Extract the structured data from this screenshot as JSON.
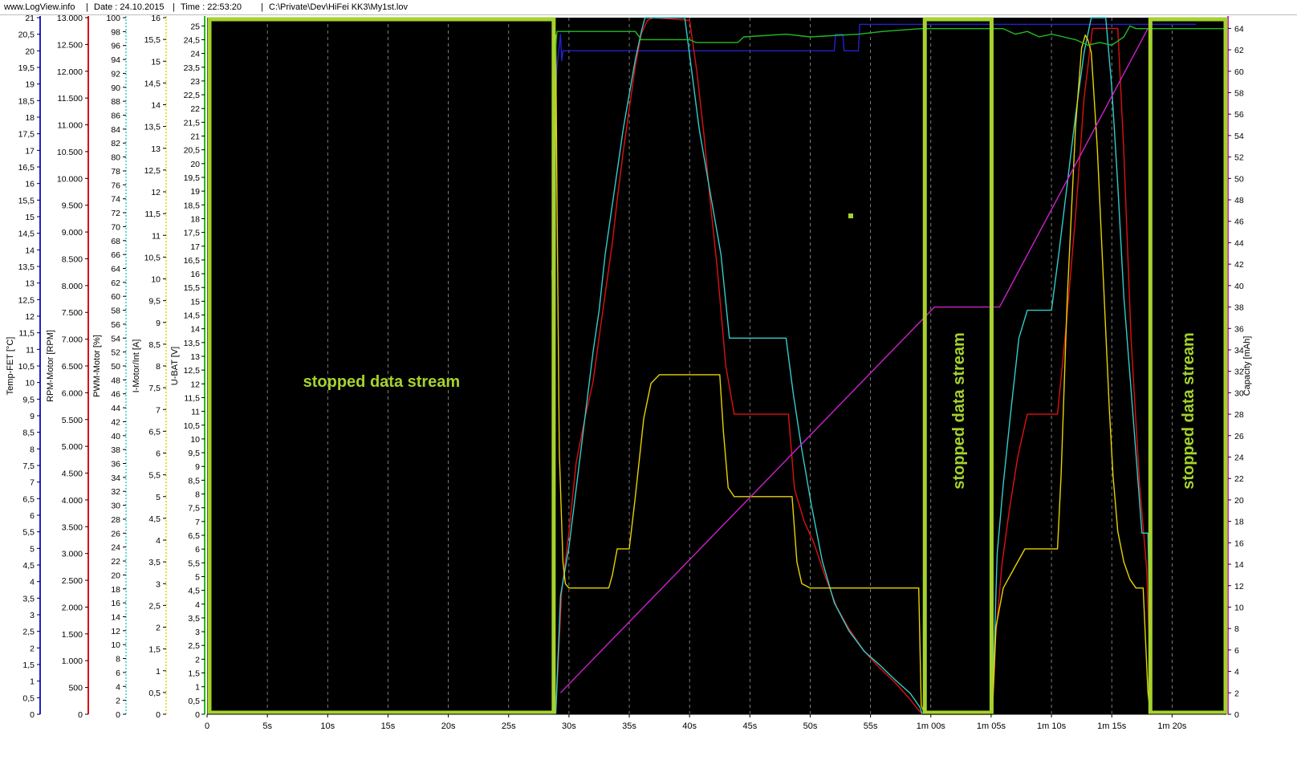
{
  "header": {
    "site": "www.LogView.info",
    "date": "Date : 24.10.2015",
    "time": "Time : 22:53:20",
    "path": "C:\\Private\\Dev\\HiFei KK3\\My1st.lov",
    "separator": "|"
  },
  "chart_data": {
    "type": "line",
    "x_unit": "s",
    "xlim": [
      0,
      84.5
    ],
    "x_ticks": [
      {
        "v": 0,
        "label": "0"
      },
      {
        "v": 5,
        "label": "5s"
      },
      {
        "v": 10,
        "label": "10s"
      },
      {
        "v": 15,
        "label": "15s"
      },
      {
        "v": 20,
        "label": "20s"
      },
      {
        "v": 25,
        "label": "25s"
      },
      {
        "v": 30,
        "label": "30s"
      },
      {
        "v": 35,
        "label": "35s"
      },
      {
        "v": 40,
        "label": "40s"
      },
      {
        "v": 45,
        "label": "45s"
      },
      {
        "v": 50,
        "label": "50s"
      },
      {
        "v": 55,
        "label": "55s"
      },
      {
        "v": 60,
        "label": "1m 00s"
      },
      {
        "v": 65,
        "label": "1m 05s"
      },
      {
        "v": 70,
        "label": "1m 10s"
      },
      {
        "v": 75,
        "label": "1m 15s"
      },
      {
        "v": 80,
        "label": "1m 20s"
      }
    ],
    "grid": "vertical dashed",
    "background": "#000000",
    "axes": [
      {
        "id": "temp",
        "label": "Temp-FET [°C]",
        "color": "#2222cc",
        "side": "left",
        "min": 0,
        "max": 21,
        "step": 0.5,
        "decimal": ","
      },
      {
        "id": "rpm",
        "label": "RPM-Motor [RPM]",
        "color": "#dd1111",
        "side": "left",
        "min": 0,
        "max": 13000,
        "step": 500,
        "thousands": "."
      },
      {
        "id": "pwm",
        "label": "PWM-Motor [%]",
        "color": "#33cccc",
        "side": "left",
        "min": 0,
        "max": 100,
        "step": 2
      },
      {
        "id": "imot",
        "label": "I-Motor/Int [A]",
        "color": "#e8d200",
        "side": "left",
        "min": 0,
        "max": 16,
        "step": 0.5,
        "decimal": ","
      },
      {
        "id": "ubat",
        "label": "U-BAT [V]",
        "color": "#22bb22",
        "side": "left",
        "min": 0,
        "max": 25.3,
        "step": 0.5,
        "decimal": ","
      },
      {
        "id": "cap",
        "label": "Capacity [mAh]",
        "color": "#cc22cc",
        "side": "right",
        "min": 0,
        "max": 65,
        "step": 2
      }
    ],
    "annotation_color": "#a6d22e",
    "annotations": [
      {
        "text": "stopped data stream",
        "x0": 0,
        "x1": 28.8,
        "orientation": "horizontal"
      },
      {
        "text": "stopped data stream",
        "x0": 59.3,
        "x1": 65.1,
        "orientation": "vertical"
      },
      {
        "text": "stopped data stream",
        "x0": 78,
        "x1": 84.5,
        "orientation": "vertical"
      }
    ],
    "series": [
      {
        "name": "Temp-FET",
        "axis": "temp",
        "color": "#2222cc",
        "x": [
          28.8,
          28.9,
          29.0,
          29.3,
          29.4,
          29.5,
          52.0,
          52.1,
          52.7,
          52.8,
          54.0,
          54.1,
          60.5,
          82
        ],
        "y": [
          0,
          18.5,
          19.5,
          20.5,
          19.7,
          20,
          20,
          20.5,
          20.5,
          20,
          20,
          20.8,
          20.8,
          20.8
        ]
      },
      {
        "name": "RPM-Motor",
        "axis": "rpm",
        "color": "#dd1111",
        "x": [
          28.9,
          29.4,
          30.0,
          30.6,
          31.3,
          32.0,
          32.6,
          33.1,
          33.6,
          34.0,
          34.5,
          35.0,
          35.5,
          36.0,
          36.5,
          37.0,
          40.0,
          40.6,
          41.2,
          41.7,
          42.3,
          43.0,
          43.7,
          48.2,
          48.7,
          49.5,
          50.3,
          51.2,
          52.2,
          53.2,
          54.4,
          55.6,
          57.0,
          58.2,
          58.9,
          59.3,
          65.1,
          65.4,
          65.9,
          66.5,
          67.2,
          68.0,
          70.5,
          71.2,
          72.0,
          72.7,
          73.4,
          75.5,
          76.0,
          76.6,
          77.3,
          77.9,
          78.3
        ],
        "y": [
          0,
          2300,
          3400,
          4700,
          5500,
          6200,
          7200,
          8000,
          8800,
          9600,
          10500,
          11300,
          12100,
          12700,
          12950,
          13000,
          12950,
          12000,
          10800,
          9600,
          8300,
          6500,
          5600,
          5600,
          4200,
          3600,
          3200,
          2600,
          2000,
          1600,
          1200,
          900,
          600,
          300,
          100,
          0,
          0,
          1500,
          2800,
          3800,
          4800,
          5600,
          5600,
          7200,
          9300,
          11500,
          12800,
          12800,
          10500,
          7000,
          4300,
          2700,
          0
        ]
      },
      {
        "name": "PWM-Motor",
        "axis": "pwm",
        "color": "#33cccc",
        "x": [
          28.9,
          29.3,
          30.0,
          30.5,
          31.0,
          31.5,
          32.0,
          32.5,
          33.0,
          33.5,
          34.0,
          34.5,
          35.0,
          35.5,
          36.0,
          36.3,
          36.8,
          39.6,
          40.2,
          40.8,
          41.4,
          42.0,
          42.6,
          43.3,
          48.0,
          48.6,
          49.3,
          50.1,
          51.0,
          52.0,
          53.2,
          54.5,
          55.8,
          57.0,
          58.3,
          59.1,
          59.3,
          65.1,
          65.5,
          66.0,
          66.6,
          67.3,
          68.0,
          70.0,
          70.6,
          71.3,
          72.0,
          72.7,
          73.3,
          74.5,
          75.0,
          75.5,
          76.0,
          76.8,
          77.5,
          78.0,
          78.3
        ],
        "y": [
          0,
          17,
          24,
          31,
          38,
          45,
          52,
          58,
          66,
          72,
          78,
          84,
          89,
          94,
          98,
          100,
          100,
          100,
          92,
          84,
          78,
          72,
          66,
          54,
          54,
          46,
          38,
          30,
          22,
          16,
          12,
          9,
          7,
          5,
          3,
          1,
          0,
          0,
          23,
          33,
          43,
          54,
          58,
          58,
          66,
          76,
          86,
          95,
          100,
          100,
          90,
          76,
          60,
          42,
          26,
          26,
          0
        ]
      },
      {
        "name": "I-Motor/Int",
        "axis": "imot",
        "color": "#e8d200",
        "x": [
          28.6,
          28.8,
          28.9,
          29.0,
          29.2,
          29.5,
          29.7,
          30.0,
          30.4,
          31.0,
          33.3,
          33.6,
          34.0,
          35.0,
          35.5,
          36.2,
          36.8,
          37.5,
          42.5,
          42.8,
          43.2,
          43.7,
          48.5,
          48.9,
          49.3,
          50.0,
          55.0,
          59.0,
          59.2,
          59.5,
          60.5,
          65.1,
          65.4,
          66.0,
          67.0,
          67.8,
          68.0,
          70.5,
          70.8,
          71.3,
          72.0,
          72.5,
          72.8,
          73.0,
          73.3,
          73.8,
          74.3,
          74.8,
          75.1,
          75.5,
          76.0,
          76.5,
          77.0,
          77.6,
          78.0,
          78.2
        ],
        "y": [
          10.2,
          8,
          15.6,
          12,
          6,
          3.5,
          3,
          2.9,
          2.9,
          2.9,
          2.9,
          3.2,
          3.8,
          3.8,
          5.0,
          6.8,
          7.6,
          7.8,
          7.8,
          6.5,
          5.2,
          5.0,
          5.0,
          3.5,
          3.0,
          2.9,
          2.9,
          2.9,
          0.2,
          0,
          0,
          0,
          2.0,
          2.9,
          3.4,
          3.8,
          3.8,
          3.8,
          5.5,
          9.5,
          13.5,
          15.3,
          15.6,
          15.5,
          15.2,
          13.0,
          10.0,
          7.0,
          5.5,
          4.2,
          3.5,
          3.1,
          2.9,
          2.9,
          0.5,
          0
        ]
      },
      {
        "name": "U-BAT",
        "axis": "ubat",
        "color": "#22bb22",
        "x": [
          28.8,
          28.9,
          29.0,
          29.2,
          35.5,
          36.0,
          40.0,
          40.5,
          44.0,
          44.5,
          48.0,
          50.0,
          54.0,
          56.0,
          59.2,
          65.0,
          66.0,
          67.0,
          68.0,
          69.0,
          70.0,
          71.0,
          72.0,
          73.0,
          74.0,
          75.0,
          76.0,
          76.5,
          77.0,
          80.0,
          84.5
        ],
        "y": [
          22.5,
          24.2,
          24.8,
          24.8,
          24.8,
          24.5,
          24.5,
          24.4,
          24.4,
          24.6,
          24.7,
          24.6,
          24.7,
          24.8,
          24.9,
          24.9,
          24.9,
          24.7,
          24.8,
          24.6,
          24.7,
          24.6,
          24.5,
          24.3,
          24.4,
          24.3,
          24.6,
          25.0,
          24.9,
          24.9,
          24.9
        ]
      },
      {
        "name": "Capacity",
        "axis": "cap",
        "color": "#cc22cc",
        "x": [
          29.3,
          60.3,
          65.7,
          78.0
        ],
        "y": [
          2,
          38,
          38,
          64
        ]
      }
    ]
  }
}
